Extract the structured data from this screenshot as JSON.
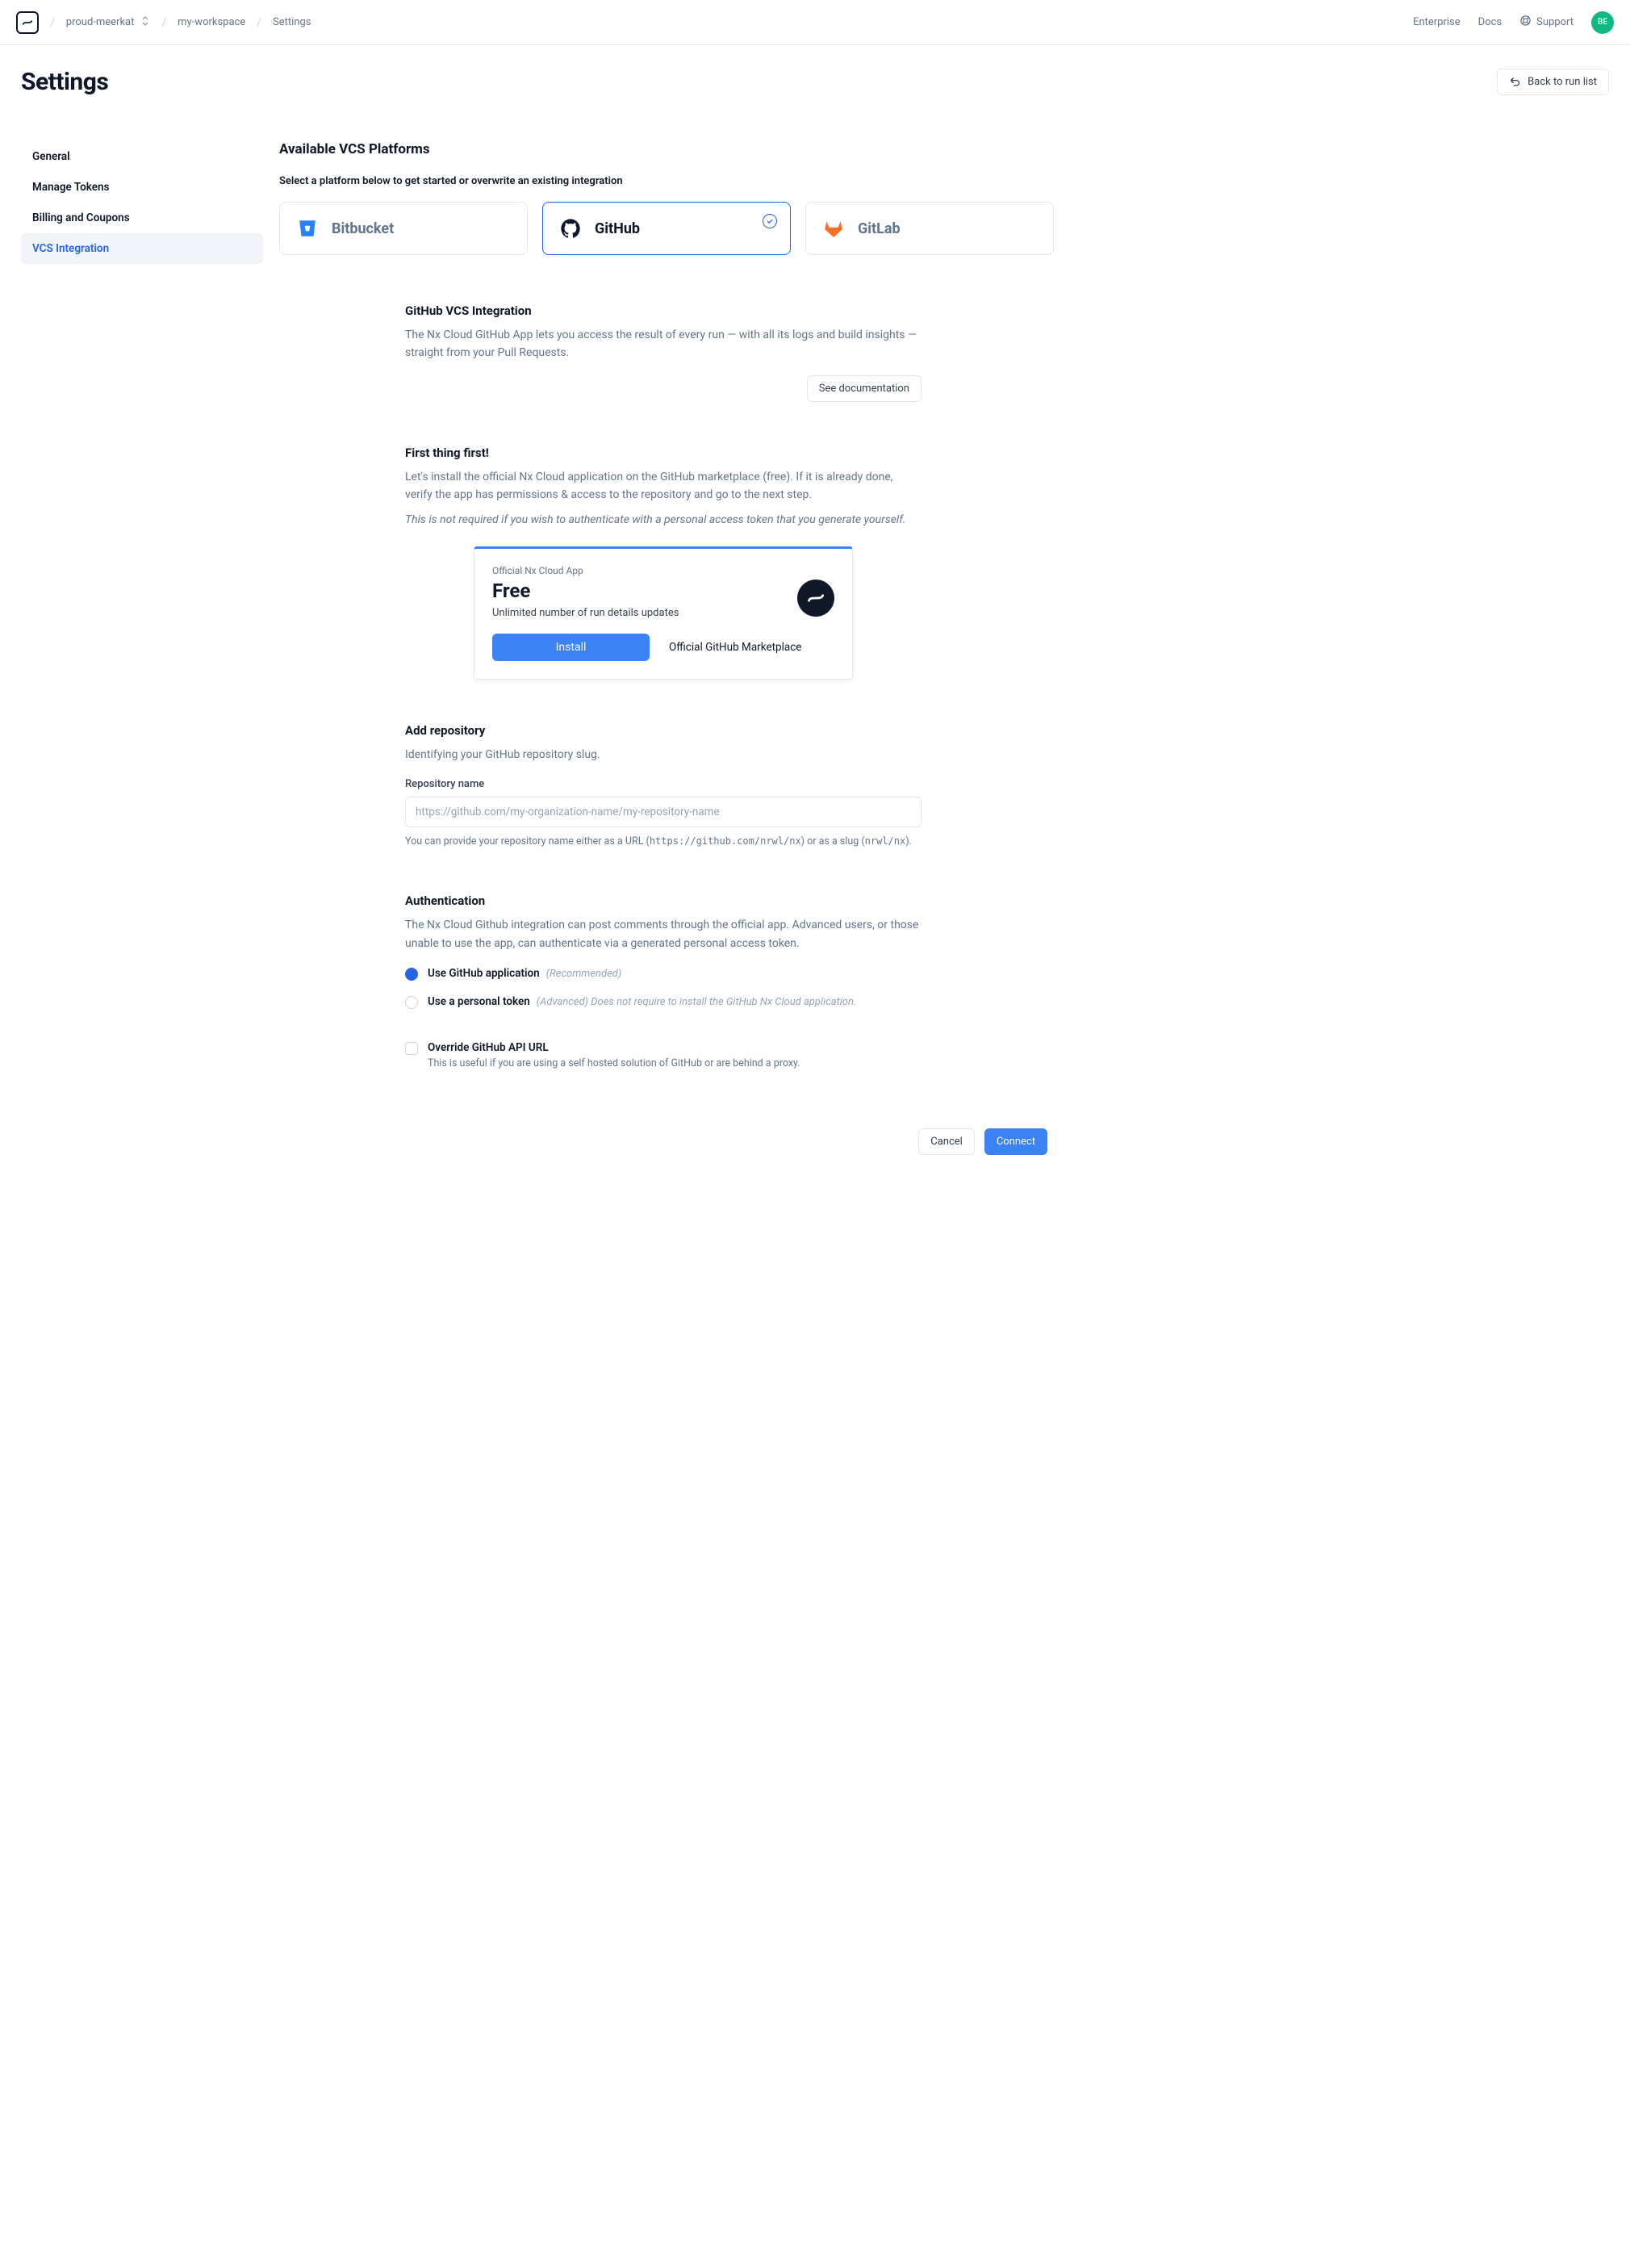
{
  "topbar": {
    "breadcrumb": {
      "org": "proud-meerkat",
      "workspace": "my-workspace",
      "current": "Settings"
    },
    "links": {
      "enterprise": "Enterprise",
      "docs": "Docs",
      "support": "Support"
    },
    "avatar_initials": "BE"
  },
  "page": {
    "title": "Settings",
    "back_button": "Back to run list"
  },
  "sidebar": {
    "items": [
      {
        "label": "General"
      },
      {
        "label": "Manage Tokens"
      },
      {
        "label": "Billing and Coupons"
      },
      {
        "label": "VCS Integration"
      }
    ]
  },
  "vcs": {
    "title": "Available VCS Platforms",
    "subtitle": "Select a platform below to get started or overwrite an existing integration",
    "platforms": {
      "bitbucket": "Bitbucket",
      "github": "GitHub",
      "gitlab": "GitLab"
    }
  },
  "github_section": {
    "title": "GitHub VCS Integration",
    "desc": "The Nx Cloud GitHub App lets you access the result of every run — with all its logs and build insights — straight from your Pull Requests.",
    "doc_button": "See documentation"
  },
  "first_thing": {
    "title": "First thing first!",
    "p1": "Let's install the official Nx Cloud application on the GitHub marketplace (free). If it is already done, verify the app has permissions & access to the repository and go to the next step.",
    "p2": "This is not required if you wish to authenticate with a personal access token that you generate yourself.",
    "card": {
      "label": "Official Nx Cloud App",
      "price": "Free",
      "desc": "Unlimited number of run details updates",
      "install": "Install",
      "marketplace": "Official GitHub Marketplace"
    }
  },
  "add_repo": {
    "title": "Add repository",
    "desc": "Identifying your GitHub repository slug.",
    "field_label": "Repository name",
    "placeholder": "https://github.com/my-organization-name/my-repository-name",
    "helper_pre": "You can provide your repository name either as a URL (",
    "helper_code1": "https://github.com/nrwl/nx",
    "helper_mid": ") or as a slug (",
    "helper_code2": "nrwl/nx",
    "helper_post": ")."
  },
  "auth": {
    "title": "Authentication",
    "desc": "The Nx Cloud Github integration can post comments through the official app. Advanced users, or those unable to use the app, can authenticate via a generated personal access token.",
    "opt1_label": "Use GitHub application",
    "opt1_hint": "(Recommended)",
    "opt2_label": "Use a personal token",
    "opt2_hint": "(Advanced) Does not require to install the GitHub Nx Cloud application.",
    "override_label": "Override GitHub API URL",
    "override_hint": "This is useful if you are using a self hosted solution of GitHub or are behind a proxy."
  },
  "footer": {
    "cancel": "Cancel",
    "connect": "Connect"
  }
}
